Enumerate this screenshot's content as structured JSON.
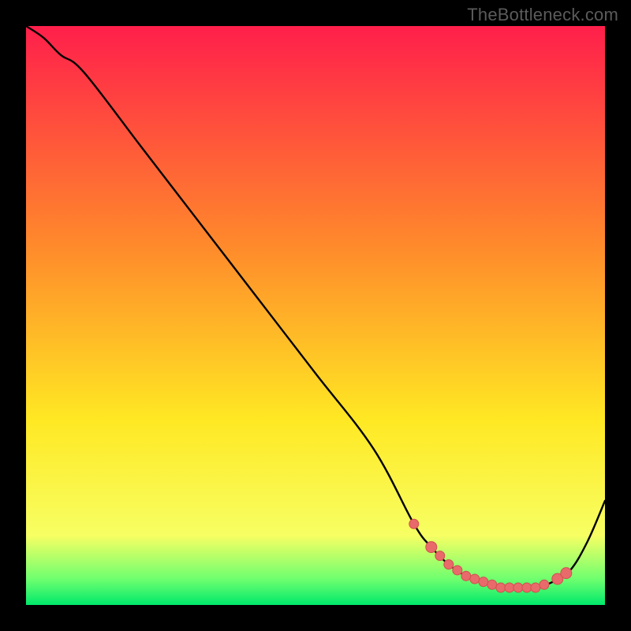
{
  "watermark": "TheBottleneck.com",
  "colors": {
    "gradient_top": "#ff1f4b",
    "gradient_mid1": "#ff8a2b",
    "gradient_mid2": "#ffe823",
    "gradient_low": "#f7ff63",
    "gradient_green1": "#6fff6f",
    "gradient_green2": "#00e96b",
    "curve": "#000000",
    "marker_fill": "#e86a6a",
    "marker_stroke": "#d24f4f"
  },
  "chart_data": {
    "type": "line",
    "title": "",
    "xlabel": "",
    "ylabel": "",
    "xlim": [
      0,
      100
    ],
    "ylim": [
      0,
      100
    ],
    "x": [
      0,
      3,
      6,
      10,
      20,
      30,
      40,
      50,
      60,
      67,
      70,
      73,
      76,
      79,
      82,
      85,
      88,
      91,
      94,
      97,
      100
    ],
    "values": [
      100,
      98,
      95,
      92,
      79,
      66,
      53,
      40,
      27,
      14,
      10,
      7,
      5,
      4,
      3,
      3,
      3,
      4,
      6,
      11,
      18
    ],
    "markers_x": [
      67,
      70,
      71.5,
      73,
      74.5,
      76,
      77.5,
      79,
      80.5,
      82,
      83.5,
      85,
      86.5,
      88,
      89.5,
      91.8,
      93.3
    ],
    "markers_y": [
      14,
      10,
      8.5,
      7,
      6.0,
      5,
      4.5,
      4,
      3.5,
      3,
      3.0,
      3,
      3.0,
      3,
      3.5,
      4.5,
      5.5
    ],
    "marker_radii": [
      6,
      7,
      6,
      6,
      6,
      6,
      6,
      6,
      6,
      6,
      6,
      6,
      6,
      6,
      6,
      7,
      7
    ]
  }
}
